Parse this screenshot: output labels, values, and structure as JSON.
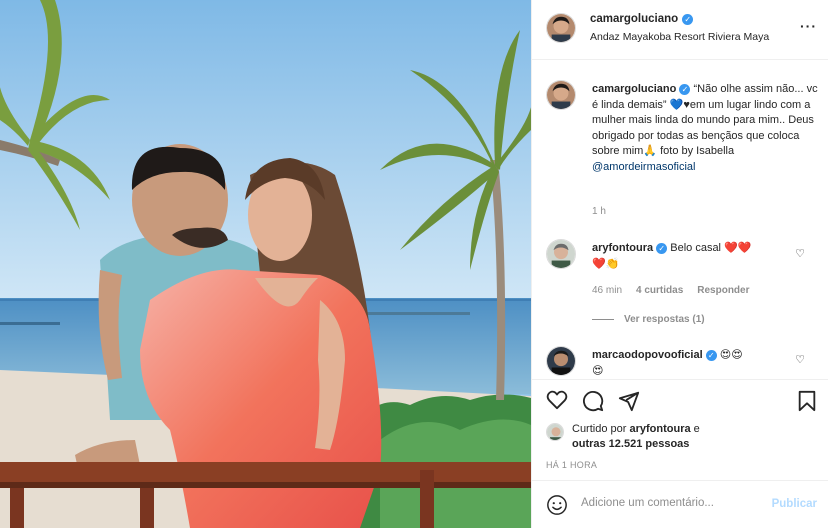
{
  "post": {
    "username": "camargoluciano",
    "location": "Andaz Mayakoba Resort Riviera Maya",
    "more_icon": "more-horizontal-icon",
    "photo_description_icon": "post-photo"
  },
  "caption": {
    "username": "camargoluciano",
    "text_a": "“Não olhe assim não... vc é linda demais”",
    "heart": "💙",
    "text_b": "♥em um lugar lindo com a mulher mais linda do mundo para mim.. Deus obrigado por todas as bençãos que coloca sobre mim",
    "pray": "🙏",
    "text_c": " foto by Isabella ",
    "mention": "@amordeirmasoficial",
    "time": "1 h"
  },
  "comments": [
    {
      "username": "aryfontoura",
      "text": "Belo casal",
      "emojis_line1": "❤️❤️",
      "emojis_line2": "❤️👏",
      "time": "46 min",
      "likes": "4 curtidas",
      "reply": "Responder",
      "view_replies": "Ver respostas (1)"
    },
    {
      "username": "marcaodopovooficial",
      "emojis_line1": "😍😍",
      "emojis_line2": "😍"
    }
  ],
  "actions": {
    "like_icon": "heart-icon",
    "comment_icon": "comment-icon",
    "share_icon": "share-icon",
    "save_icon": "bookmark-icon"
  },
  "likes": {
    "prefix": "Curtido por ",
    "user": "aryfontoura",
    "middle": " e",
    "others": "outras 12.521 pessoas"
  },
  "time_ago": "HÁ 1 HORA",
  "add_comment": {
    "placeholder": "Adicione um comentário...",
    "publish": "Publicar"
  },
  "colors": {
    "verified": "#3897f0",
    "link": "#00376b",
    "muted": "#8e8e8e",
    "publish_disabled": "#b3dbff"
  }
}
